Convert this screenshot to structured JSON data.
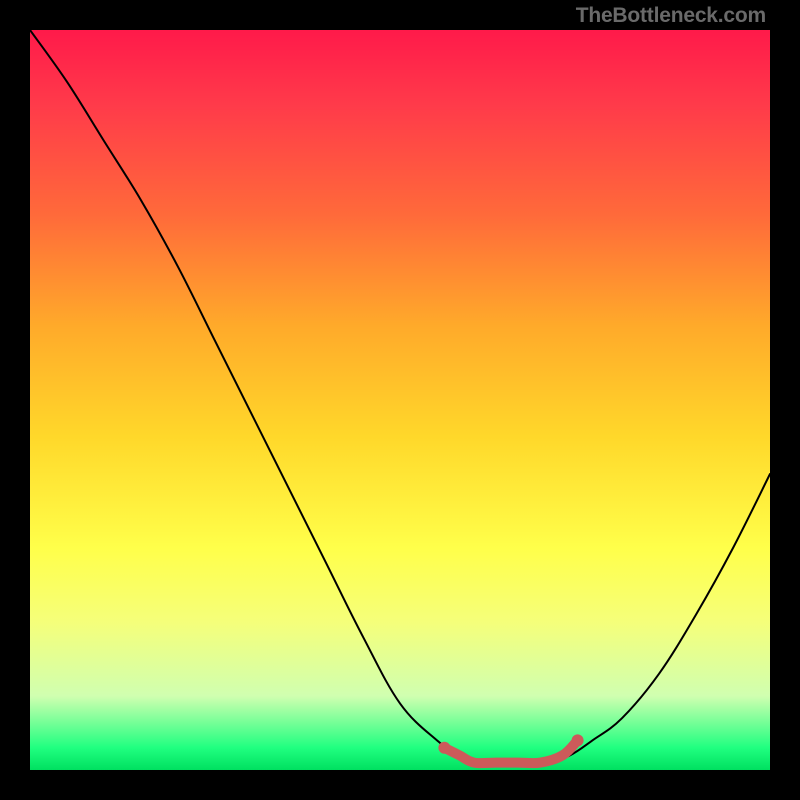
{
  "watermark": "TheBottleneck.com",
  "chart_data": {
    "type": "line",
    "title": "",
    "xlabel": "",
    "ylabel": "",
    "xlim": [
      0,
      100
    ],
    "ylim": [
      0,
      100
    ],
    "series": [
      {
        "name": "bottleneck-curve",
        "x": [
          0,
          5,
          10,
          15,
          20,
          25,
          30,
          35,
          40,
          45,
          50,
          55,
          58,
          60,
          63,
          66,
          70,
          73,
          76,
          80,
          85,
          90,
          95,
          100
        ],
        "y": [
          100,
          93,
          85,
          77,
          68,
          58,
          48,
          38,
          28,
          18,
          9,
          4,
          2,
          1,
          1,
          1,
          1,
          2,
          4,
          7,
          13,
          21,
          30,
          40
        ],
        "color": "#000000",
        "width": 2
      },
      {
        "name": "optimal-highlight",
        "x": [
          56,
          58,
          60,
          63,
          66,
          69,
          72,
          74
        ],
        "y": [
          3,
          2,
          1,
          1,
          1,
          1,
          2,
          4
        ],
        "color": "#cc5a5a",
        "width": 10
      }
    ],
    "background_gradient": {
      "top": "#ff1a4a",
      "mid": "#ffd82a",
      "bottom": "#00e060"
    }
  }
}
